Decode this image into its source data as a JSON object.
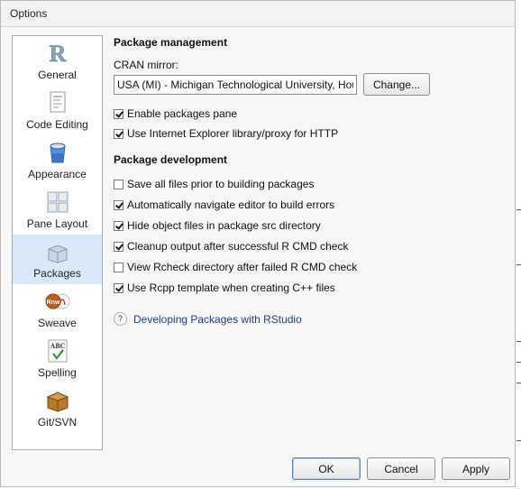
{
  "window": {
    "title": "Options"
  },
  "sidebar": {
    "items": [
      {
        "label": "General",
        "icon": "r-logo-icon",
        "selected": false
      },
      {
        "label": "Code Editing",
        "icon": "code-document-icon",
        "selected": false
      },
      {
        "label": "Appearance",
        "icon": "paint-bucket-icon",
        "selected": false
      },
      {
        "label": "Pane Layout",
        "icon": "pane-layout-icon",
        "selected": false
      },
      {
        "label": "Packages",
        "icon": "package-icon",
        "selected": true
      },
      {
        "label": "Sweave",
        "icon": "rnw-pdf-icon",
        "selected": false
      },
      {
        "label": "Spelling",
        "icon": "abc-check-icon",
        "selected": false
      },
      {
        "label": "Git/SVN",
        "icon": "box-icon",
        "selected": false
      }
    ]
  },
  "package_management": {
    "title": "Package management",
    "cran_label": "CRAN mirror:",
    "cran_value": "USA (MI) - Michigan Technological University, Houghton",
    "change_label": "Change...",
    "options": [
      {
        "label": "Enable packages pane",
        "checked": true
      },
      {
        "label": "Use Internet Explorer library/proxy for HTTP",
        "checked": true
      }
    ]
  },
  "package_development": {
    "title": "Package development",
    "options": [
      {
        "label": "Save all files prior to building packages",
        "checked": false
      },
      {
        "label": "Automatically navigate editor to build errors",
        "checked": true
      },
      {
        "label": "Hide object files in package src directory",
        "checked": true
      },
      {
        "label": "Cleanup output after successful R CMD check",
        "checked": true
      },
      {
        "label": "View Rcheck directory after failed R CMD check",
        "checked": false
      },
      {
        "label": "Use Rcpp template when creating C++ files",
        "checked": true
      }
    ]
  },
  "help": {
    "icon_text": "?",
    "link_label": "Developing Packages with RStudio"
  },
  "footer": {
    "ok_label": "OK",
    "cancel_label": "Cancel",
    "apply_label": "Apply"
  },
  "colors": {
    "selection": "#d9e9fa",
    "link": "#1f3e8f",
    "accent_border": "#5d7fbf"
  }
}
